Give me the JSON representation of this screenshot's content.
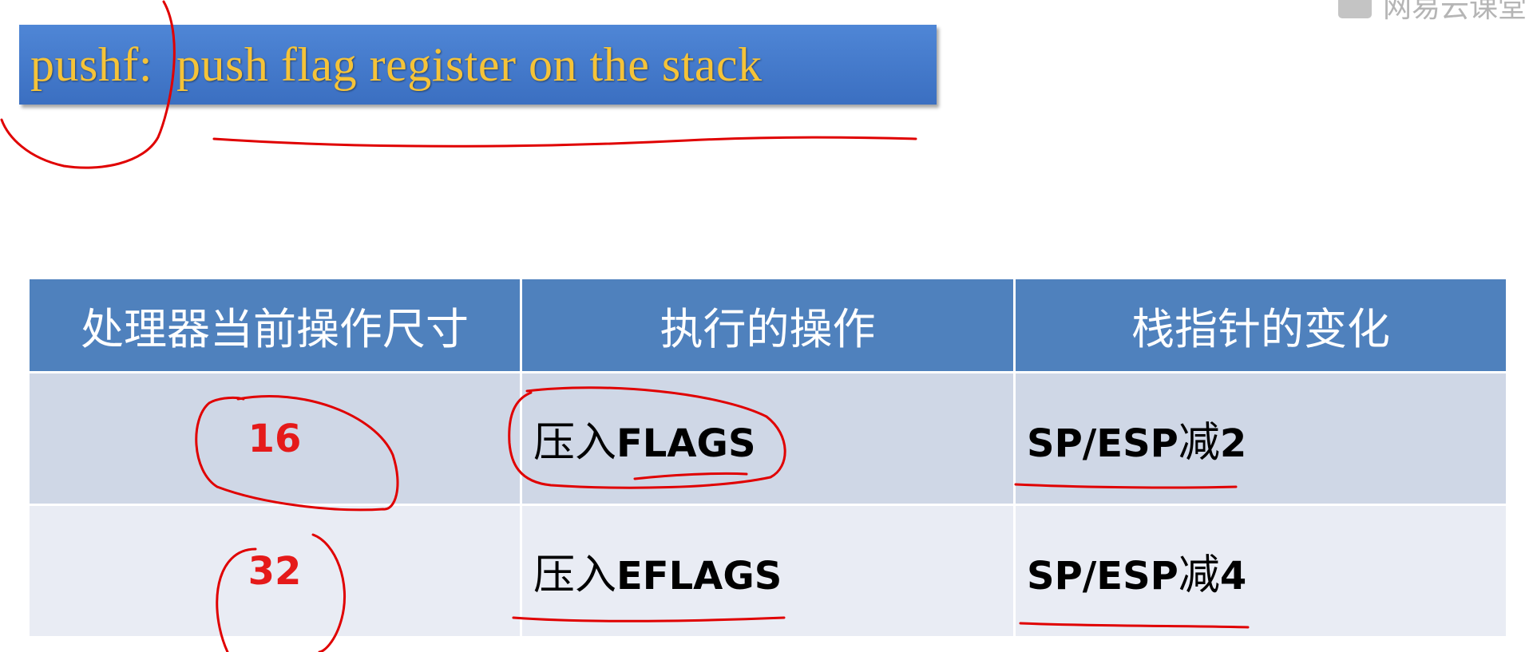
{
  "title": {
    "command": "pushf:",
    "description": "push flag register on the stack",
    "bar_color": "#3f74c6",
    "text_color": "#f5c338"
  },
  "watermark": {
    "icon": "classroom-logo-icon",
    "text": "网易云课堂"
  },
  "table": {
    "header_color": "#4f81bd",
    "row_colors": [
      "#cfd7e6",
      "#e9ecf4"
    ],
    "headers": [
      "处理器当前操作尺寸",
      "执行的操作",
      "栈指针的变化"
    ],
    "rows": [
      {
        "size": "16",
        "op_cn": "压入",
        "op_reg": "FLAGS",
        "sp_reg": "SP/ESP",
        "sp_cn": "减",
        "sp_num": "2"
      },
      {
        "size": "32",
        "op_cn": "压入",
        "op_reg": "EFLAGS",
        "sp_reg": "SP/ESP",
        "sp_cn": "减",
        "sp_num": "4"
      }
    ]
  },
  "annotation_color": "#e00000"
}
